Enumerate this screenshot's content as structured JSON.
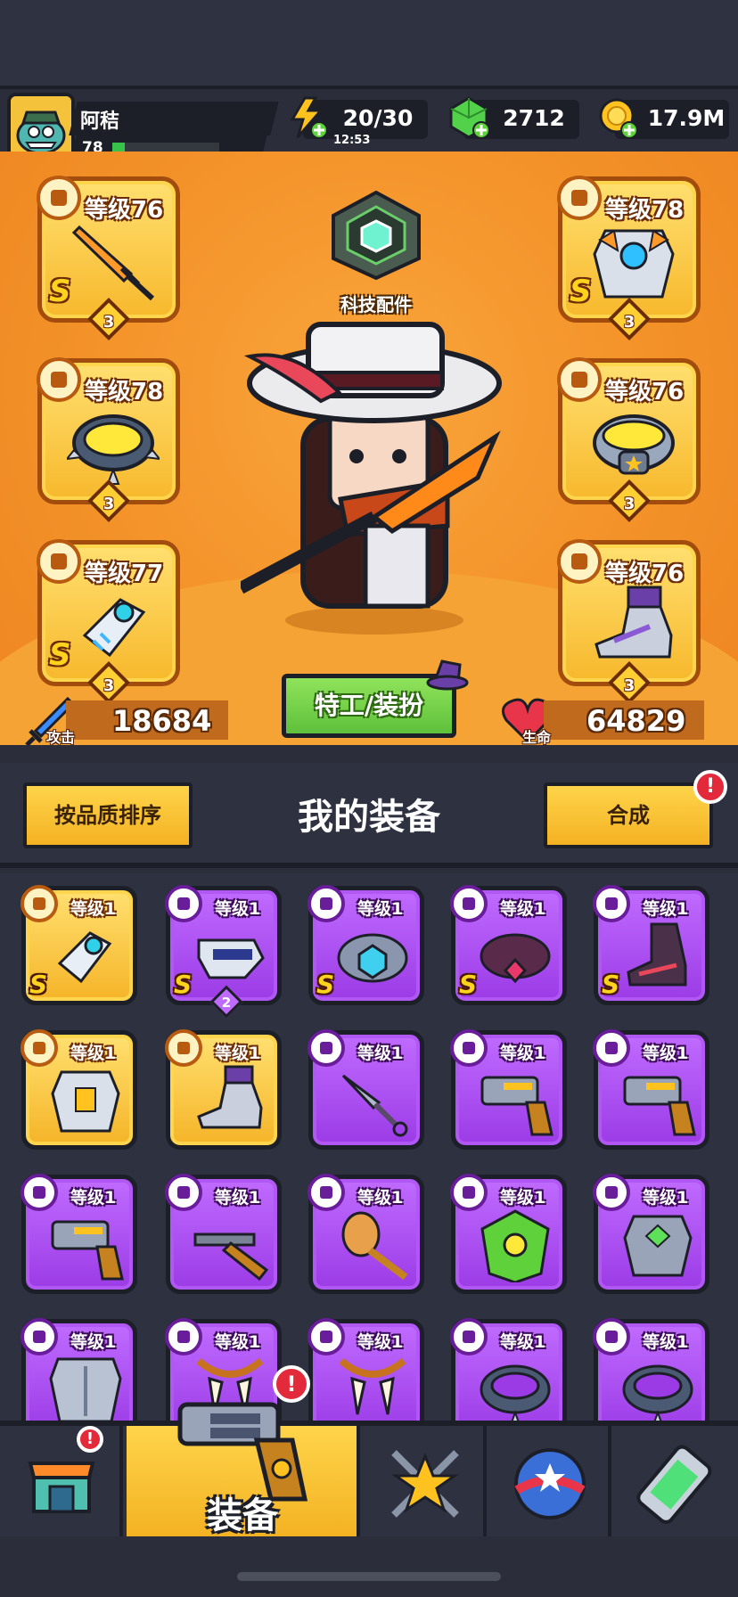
{
  "player": {
    "name": "阿秸",
    "level": "78",
    "xp_fraction": 0.12
  },
  "resources": {
    "energy": {
      "value": "20/30",
      "timer": "12:53",
      "icon": "lightning-icon"
    },
    "gems": {
      "value": "2712",
      "icon": "green-gem-icon"
    },
    "gold": {
      "value": "17.9M",
      "icon": "gold-coin-icon"
    }
  },
  "equipped": {
    "weapon": {
      "level_label": "等级76",
      "rank": "S",
      "stars": "3",
      "icon": "sword-icon"
    },
    "armor": {
      "level_label": "等级78",
      "rank": "S",
      "stars": "3",
      "icon": "chest-armor-icon"
    },
    "necklace": {
      "level_label": "等级78",
      "stars": "3",
      "icon": "spiked-collar-icon"
    },
    "belt": {
      "level_label": "等级76",
      "stars": "3",
      "icon": "belt-icon"
    },
    "gloves": {
      "level_label": "等级77",
      "rank": "S",
      "stars": "3",
      "icon": "gauntlet-icon"
    },
    "boots": {
      "level_label": "等级76",
      "stars": "3",
      "icon": "boot-icon"
    }
  },
  "tech_parts": {
    "label": "科技配件"
  },
  "stats": {
    "attack_label": "攻击",
    "attack_value": "18684",
    "hp_label": "生命",
    "hp_value": "64829"
  },
  "agent_button": {
    "label": "特工/装扮"
  },
  "toolbar": {
    "sort_label": "按品质排序",
    "title": "我的装备",
    "merge_label": "合成",
    "merge_alert": "!"
  },
  "inventory": [
    {
      "level": "等级1",
      "rarity": "gold",
      "rank": "S",
      "icon": "gauntlet-icon"
    },
    {
      "level": "等级1",
      "rarity": "purple",
      "rank": "S",
      "stars": "2",
      "icon": "laser-gun-icon"
    },
    {
      "level": "等级1",
      "rarity": "purple",
      "rank": "S",
      "icon": "gem-belt-icon"
    },
    {
      "level": "等级1",
      "rarity": "purple",
      "rank": "S",
      "icon": "dark-collar-icon"
    },
    {
      "level": "等级1",
      "rarity": "purple",
      "rank": "S",
      "icon": "dark-boot-icon"
    },
    {
      "level": "等级1",
      "rarity": "gold",
      "icon": "chest-armor-icon"
    },
    {
      "level": "等级1",
      "rarity": "gold",
      "icon": "boot-icon"
    },
    {
      "level": "等级1",
      "rarity": "purple",
      "icon": "kunai-icon"
    },
    {
      "level": "等级1",
      "rarity": "purple",
      "icon": "revolver-icon"
    },
    {
      "level": "等级1",
      "rarity": "purple",
      "icon": "revolver-icon"
    },
    {
      "level": "等级1",
      "rarity": "purple",
      "icon": "revolver-icon"
    },
    {
      "level": "等级1",
      "rarity": "purple",
      "icon": "shotgun-icon"
    },
    {
      "level": "等级1",
      "rarity": "purple",
      "icon": "spiked-club-icon"
    },
    {
      "level": "等级1",
      "rarity": "purple",
      "icon": "leaf-armor-icon"
    },
    {
      "level": "等级1",
      "rarity": "purple",
      "icon": "gem-armor-icon"
    },
    {
      "level": "等级1",
      "rarity": "purple",
      "icon": "steel-armor-icon"
    },
    {
      "level": "等级1",
      "rarity": "purple",
      "icon": "fang-necklace-icon"
    },
    {
      "level": "等级1",
      "rarity": "purple",
      "icon": "fang-necklace-icon"
    },
    {
      "level": "等级1",
      "rarity": "purple",
      "icon": "spiked-collar-icon"
    },
    {
      "level": "等级1",
      "rarity": "purple",
      "icon": "spiked-collar-icon"
    }
  ],
  "nav": {
    "tabs": [
      {
        "icon": "shop-icon",
        "alert": "!"
      },
      {
        "icon": "revolver-icon",
        "label": "装备",
        "alert": "!"
      },
      {
        "icon": "crossed-swords-star-icon"
      },
      {
        "icon": "star-ball-icon"
      },
      {
        "icon": "dna-capsule-icon"
      }
    ]
  },
  "colors": {
    "gold_rarity": "#f5b428",
    "purple_rarity": "#9b3be6",
    "stage_orange": "#f39229",
    "alert_red": "#e32a3b",
    "green_button": "#6fce44"
  }
}
